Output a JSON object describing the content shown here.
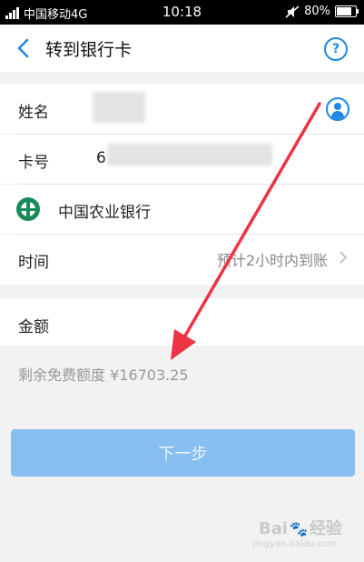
{
  "status_bar": {
    "network_tag": "46",
    "carrier": "中国移动4G",
    "time": "10:18",
    "battery_percent": "80%",
    "battery_level": 0.8
  },
  "nav": {
    "title": "转到银行卡",
    "help_symbol": "?"
  },
  "form": {
    "name_label": "姓名",
    "card_label": "卡号",
    "card_prefix": "6",
    "bank_name": "中国农业银行",
    "time_label": "时间",
    "time_value": "预计2小时内到账",
    "amount_label": "金额",
    "amount_hint": "剩余免费额度 ¥16703.25"
  },
  "buttons": {
    "next": "下一步"
  },
  "watermark": {
    "brand_prefix": "Bai",
    "brand_suffix": "经验",
    "url": "jingyan.baidu.com"
  },
  "colors": {
    "accent": "#1e88e5",
    "button": "#86bff0",
    "annotation_arrow": "#ee3344",
    "bank_logo": "#1a8a5a"
  }
}
